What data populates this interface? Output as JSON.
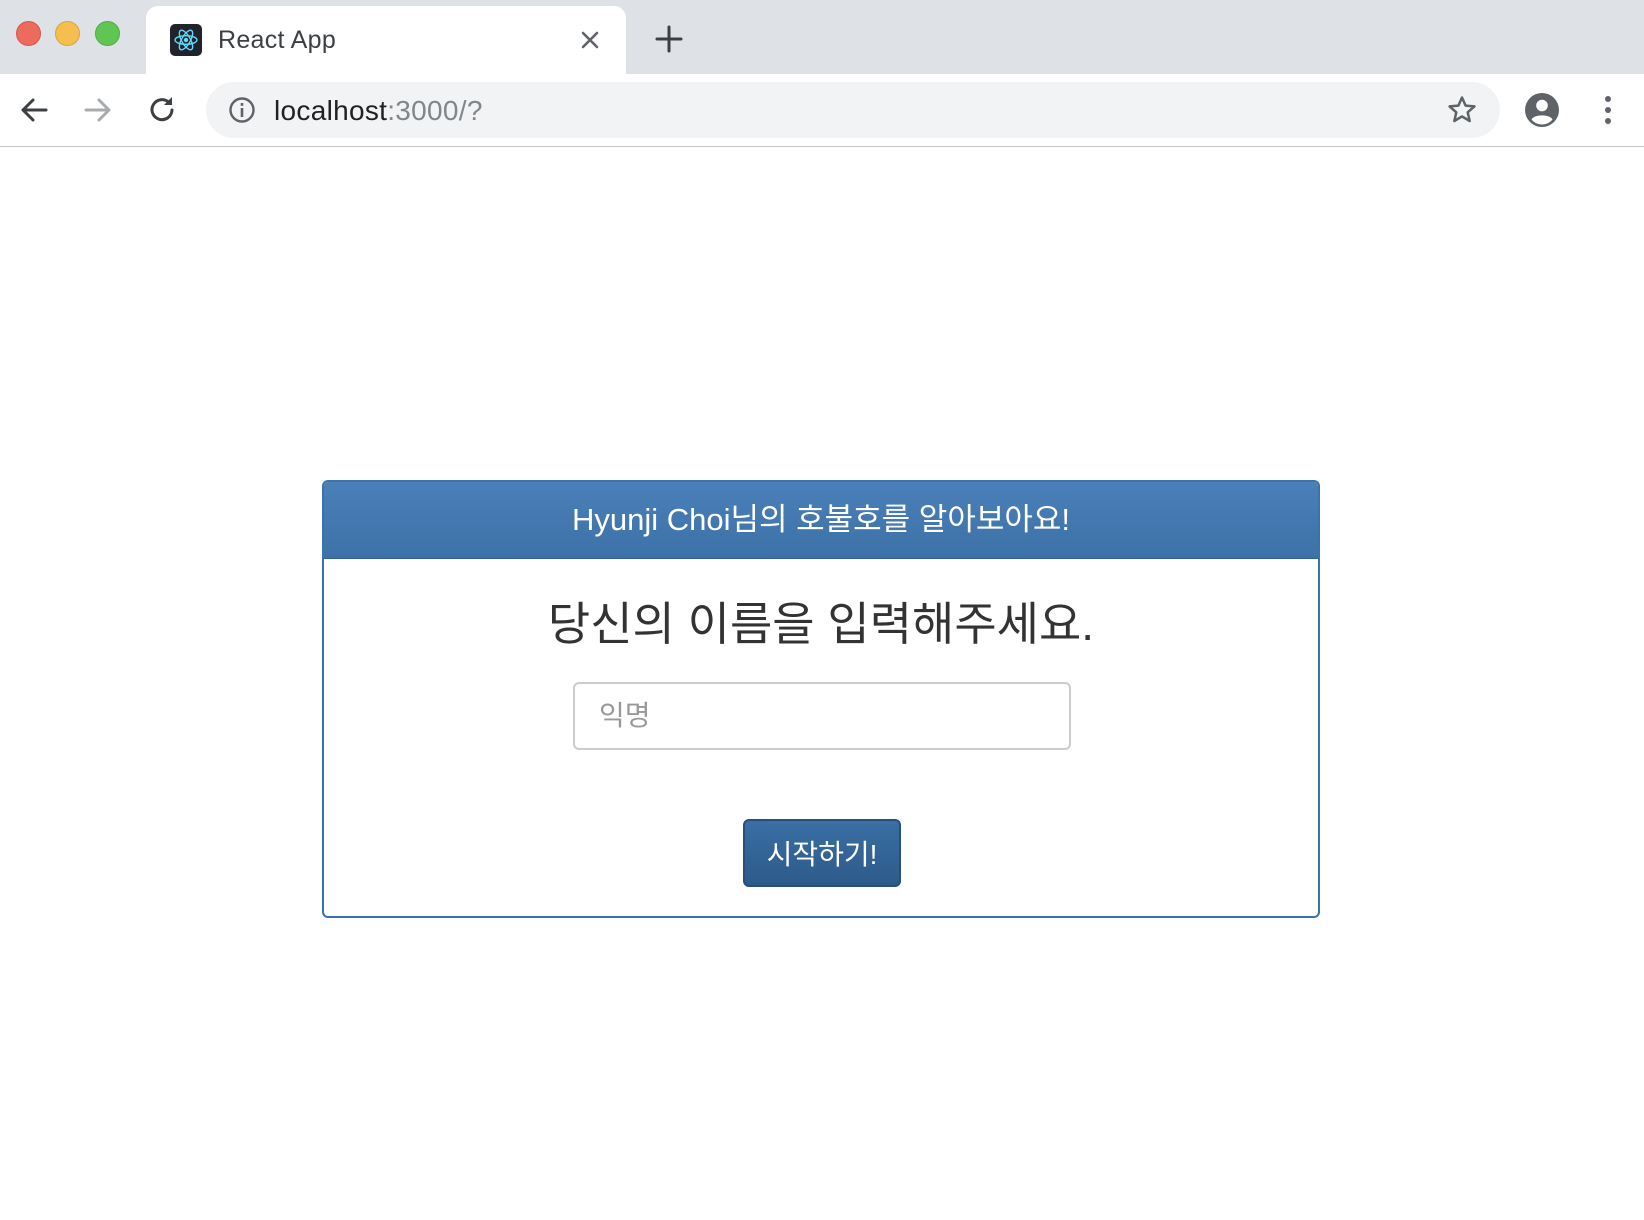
{
  "browser": {
    "tab": {
      "title": "React App",
      "favicon": "react-logo-icon"
    },
    "toolbar": {
      "url_host": "localhost",
      "url_rest": ":3000/?"
    },
    "icons": {
      "back": "arrow-left-icon",
      "forward": "arrow-right-icon",
      "reload": "reload-icon",
      "site_info": "info-icon",
      "bookmark": "star-icon",
      "profile": "account-circle-icon",
      "menu": "kebab-menu-icon",
      "tab_close": "close-icon",
      "new_tab": "plus-icon"
    }
  },
  "panel": {
    "heading": "Hyunji Choi님의 호불호를 알아보아요!",
    "question": "당신의 이름을 입력해주세요.",
    "name_input": {
      "value": "",
      "placeholder": "익명"
    },
    "start_button": "시작하기!"
  },
  "colors": {
    "panel_heading_bg": "#4178b0",
    "panel_border": "#3a73ab",
    "button_bg": "#34648f",
    "react_blue": "#61dafb"
  }
}
